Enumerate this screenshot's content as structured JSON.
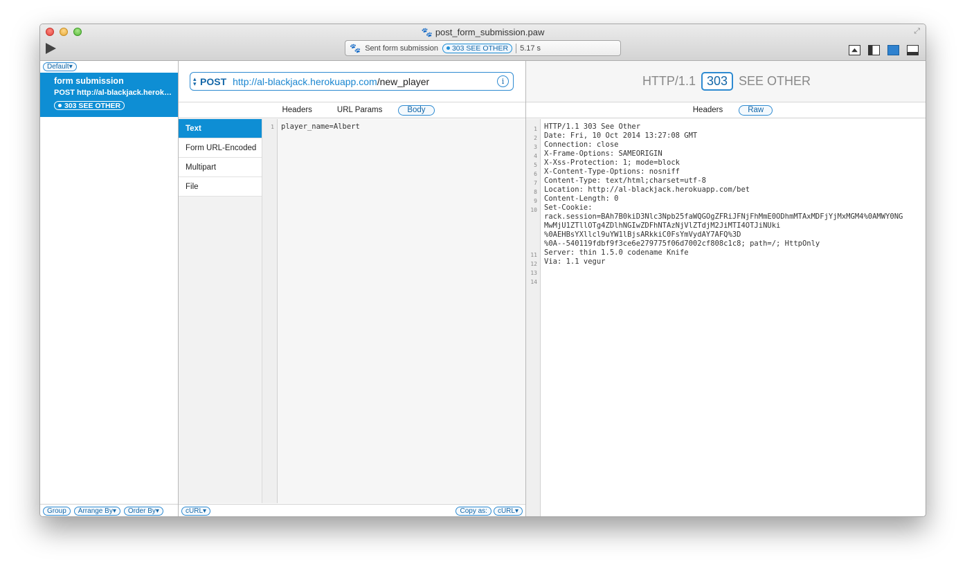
{
  "window": {
    "title": "post_form_submission.paw"
  },
  "toolbar": {
    "status_text": "Sent form submission",
    "status_code": "303 SEE OTHER",
    "elapsed": "5.17 s"
  },
  "sidebar": {
    "group_selector": "Default",
    "items": [
      {
        "name": "form submission",
        "request": "POST  http://al-blackjack.herokuapp.com/new_player",
        "status": "303 SEE OTHER"
      }
    ],
    "footer": {
      "group": "Group",
      "arrange_by": "Arrange By",
      "order_by": "Order By"
    }
  },
  "request": {
    "method": "POST",
    "url_host": "http://al-blackjack.herokuapp.com",
    "url_path": "/new_player",
    "tabs": [
      "Headers",
      "URL Params",
      "Body"
    ],
    "active_tab": "Body",
    "body_types": [
      "Text",
      "Form URL-Encoded",
      "Multipart",
      "File"
    ],
    "active_body_type": "Text",
    "body_lines": [
      "player_name=Albert"
    ],
    "footer": {
      "curl_left": "cURL",
      "copy_as": "Copy as:",
      "curl_right": "cURL"
    }
  },
  "response": {
    "protocol": "HTTP/1.1",
    "code": "303",
    "reason": "SEE OTHER",
    "tabs": [
      "Headers",
      "Raw"
    ],
    "active_tab": "Raw",
    "line_numbers": [
      "1",
      "2",
      "3",
      "4",
      "5",
      "6",
      "7",
      "8",
      "9",
      "10",
      "",
      "",
      "",
      "",
      "11",
      "12",
      "13",
      "14"
    ],
    "raw_lines": [
      "HTTP/1.1 303 See Other",
      "Date: Fri, 10 Oct 2014 13:27:08 GMT",
      "Connection: close",
      "X-Frame-Options: SAMEORIGIN",
      "X-Xss-Protection: 1; mode=block",
      "X-Content-Type-Options: nosniff",
      "Content-Type: text/html;charset=utf-8",
      "Location: http://al-blackjack.herokuapp.com/bet",
      "Content-Length: 0",
      "Set-Cookie:",
      "rack.session=BAh7B0kiD3Nlc3Npb25faWQGOgZFRiJFNjFhMmE0ODhmMTAxMDFjYjMxMGM4%0AMWY0NG",
      "MwMjU1ZTllOTg4ZDlhNGIwZDFhNTAzNjVlZTdjM2JiMTI4OTJiNUki",
      "%0AEHBsYXllcl9uYW1lBjsARkkiC0FsYmVydAY7AFQ%3D",
      "%0A--540119fdbf9f3ce6e279775f06d7002cf808c1c8; path=/; HttpOnly",
      "Server: thin 1.5.0 codename Knife",
      "Via: 1.1 vegur",
      "",
      ""
    ]
  },
  "colors": {
    "accent": "#0e8ed4",
    "pill_border": "#2d8ad1"
  }
}
